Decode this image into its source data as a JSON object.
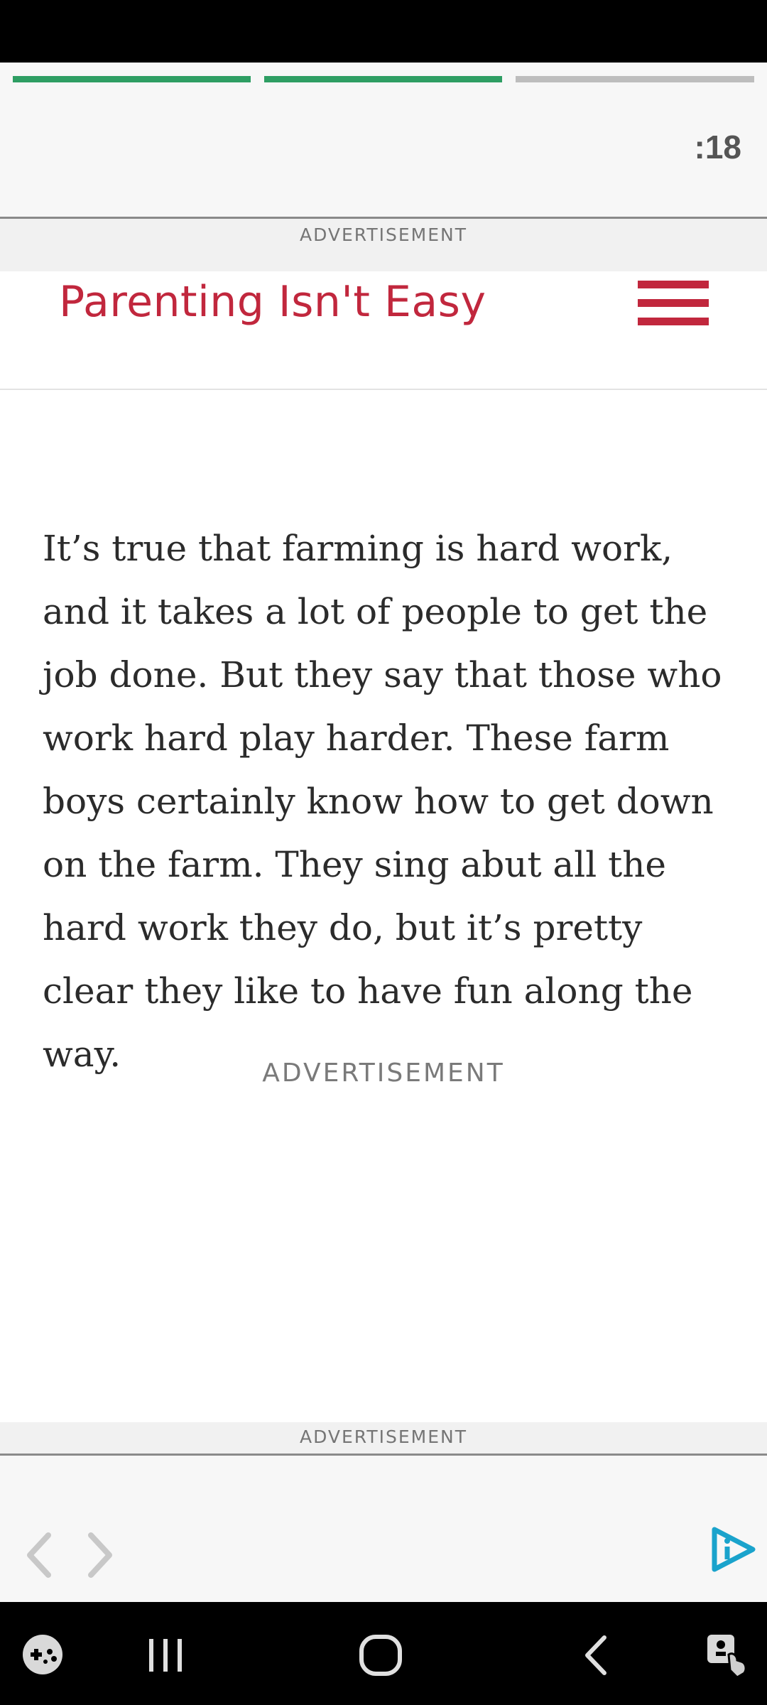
{
  "ad_top": {
    "progress": [
      {
        "state": "complete",
        "fill": 1.0
      },
      {
        "state": "complete",
        "fill": 1.0
      },
      {
        "state": "pending",
        "fill": 0.0
      }
    ],
    "timer": ":18",
    "label": "ADVERTISEMENT"
  },
  "header": {
    "logo_text": "Parenting Isn't Easy",
    "menu_icon": "hamburger-menu-icon"
  },
  "article": {
    "paragraph": "It’s true that farming is hard work, and it takes a lot of people to get the job done. But they say that those who work hard play harder. These farm boys certainly know how to get down on the farm. They sing abut all the hard work they do, but it’s pretty clear they like to have fun along the way."
  },
  "inline_ad": {
    "label": "ADVERTISEMENT"
  },
  "bottom_ad": {
    "label": "ADVERTISEMENT",
    "icons": [
      "chevron-left-icon",
      "chevron-right-icon",
      "adchoices-icon"
    ]
  },
  "system_nav": {
    "icons": [
      "game-launcher-icon",
      "recent-apps-icon",
      "home-icon",
      "back-icon",
      "accessibility-icon"
    ]
  },
  "colors": {
    "brand_red": "#c1273d",
    "progress_green": "#2e9e63",
    "progress_gray": "#bdbdbd",
    "adchoices_blue": "#1aa3cc"
  }
}
